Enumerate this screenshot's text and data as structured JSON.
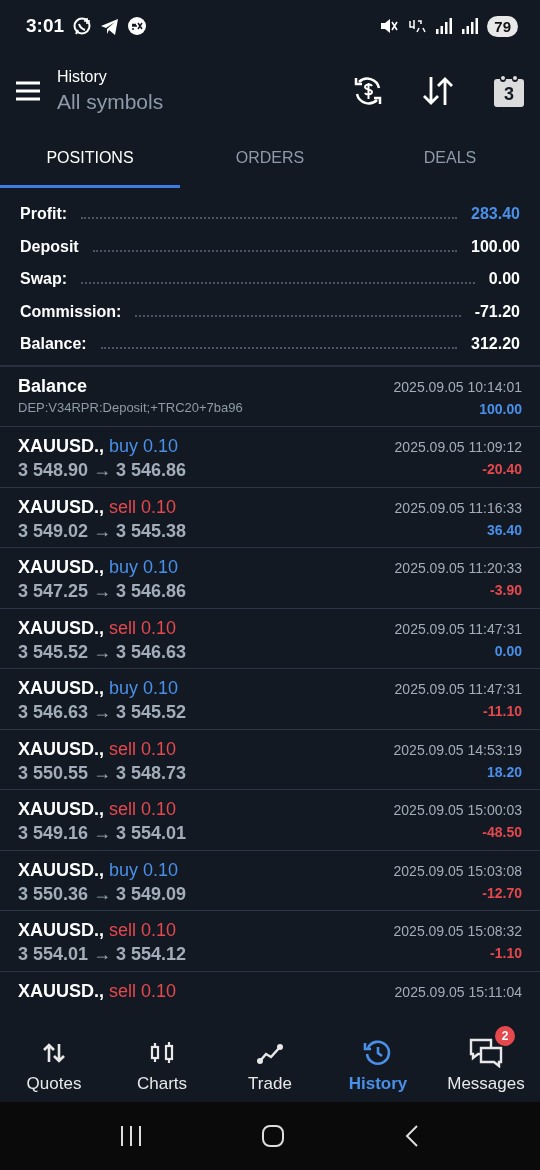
{
  "status_bar": {
    "time": "3:01",
    "battery": "79"
  },
  "header": {
    "title": "History",
    "subtitle": "All symbols",
    "calendar_day": "3"
  },
  "tabs": [
    {
      "label": "POSITIONS",
      "selected": true
    },
    {
      "label": "ORDERS",
      "selected": false
    },
    {
      "label": "DEALS",
      "selected": false
    }
  ],
  "summary": [
    {
      "label": "Profit:",
      "value": "283.40",
      "highlight": true
    },
    {
      "label": "Deposit",
      "value": "100.00",
      "highlight": false
    },
    {
      "label": "Swap:",
      "value": "0.00",
      "highlight": false
    },
    {
      "label": "Commission:",
      "value": "-71.20",
      "highlight": false
    },
    {
      "label": "Balance:",
      "value": "312.20",
      "highlight": false
    }
  ],
  "history": [
    {
      "kind": "balance",
      "title": "Balance",
      "comment": "DEP:V34RPR:Deposit;+TRC20+7ba96",
      "time": "2025.09.05 10:14:01",
      "amount": "100.00",
      "color": "#4a8fe8"
    },
    {
      "kind": "trade",
      "symbol": "XAUUSD.,",
      "side": "buy",
      "volume": "0.10",
      "prices": "3 548.90 → 3 546.86",
      "time": "2025.09.05 11:09:12",
      "amount": "-20.40",
      "color": "#e5484d"
    },
    {
      "kind": "trade",
      "symbol": "XAUUSD.,",
      "side": "sell",
      "volume": "0.10",
      "prices": "3 549.02 → 3 545.38",
      "time": "2025.09.05 11:16:33",
      "amount": "36.40",
      "color": "#4a8fe8"
    },
    {
      "kind": "trade",
      "symbol": "XAUUSD.,",
      "side": "buy",
      "volume": "0.10",
      "prices": "3 547.25 → 3 546.86",
      "time": "2025.09.05 11:20:33",
      "amount": "-3.90",
      "color": "#e5484d"
    },
    {
      "kind": "trade",
      "symbol": "XAUUSD.,",
      "side": "sell",
      "volume": "0.10",
      "prices": "3 545.52 → 3 546.63",
      "time": "2025.09.05 11:47:31",
      "amount": "0.00",
      "color": "#4a8fe8"
    },
    {
      "kind": "trade",
      "symbol": "XAUUSD.,",
      "side": "buy",
      "volume": "0.10",
      "prices": "3 546.63 → 3 545.52",
      "time": "2025.09.05 11:47:31",
      "amount": "-11.10",
      "color": "#e5484d"
    },
    {
      "kind": "trade",
      "symbol": "XAUUSD.,",
      "side": "sell",
      "volume": "0.10",
      "prices": "3 550.55 → 3 548.73",
      "time": "2025.09.05 14:53:19",
      "amount": "18.20",
      "color": "#4a8fe8"
    },
    {
      "kind": "trade",
      "symbol": "XAUUSD.,",
      "side": "sell",
      "volume": "0.10",
      "prices": "3 549.16 → 3 554.01",
      "time": "2025.09.05 15:00:03",
      "amount": "-48.50",
      "color": "#e5484d"
    },
    {
      "kind": "trade",
      "symbol": "XAUUSD.,",
      "side": "buy",
      "volume": "0.10",
      "prices": "3 550.36 → 3 549.09",
      "time": "2025.09.05 15:03:08",
      "amount": "-12.70",
      "color": "#e5484d"
    },
    {
      "kind": "trade",
      "symbol": "XAUUSD.,",
      "side": "sell",
      "volume": "0.10",
      "prices": "3 554.01 → 3 554.12",
      "time": "2025.09.05 15:08:32",
      "amount": "-1.10",
      "color": "#e5484d"
    },
    {
      "kind": "trade",
      "symbol": "XAUUSD.,",
      "side": "sell",
      "volume": "0.10",
      "time": "2025.09.05 15:11:04"
    }
  ],
  "bottom_nav": [
    {
      "kind": "quotes",
      "label": "Quotes",
      "selected": false
    },
    {
      "kind": "charts",
      "label": "Charts",
      "selected": false
    },
    {
      "kind": "trade",
      "label": "Trade",
      "selected": false
    },
    {
      "kind": "history",
      "label": "History",
      "selected": true
    },
    {
      "kind": "messages",
      "label": "Messages",
      "selected": false,
      "badge": "2"
    }
  ]
}
